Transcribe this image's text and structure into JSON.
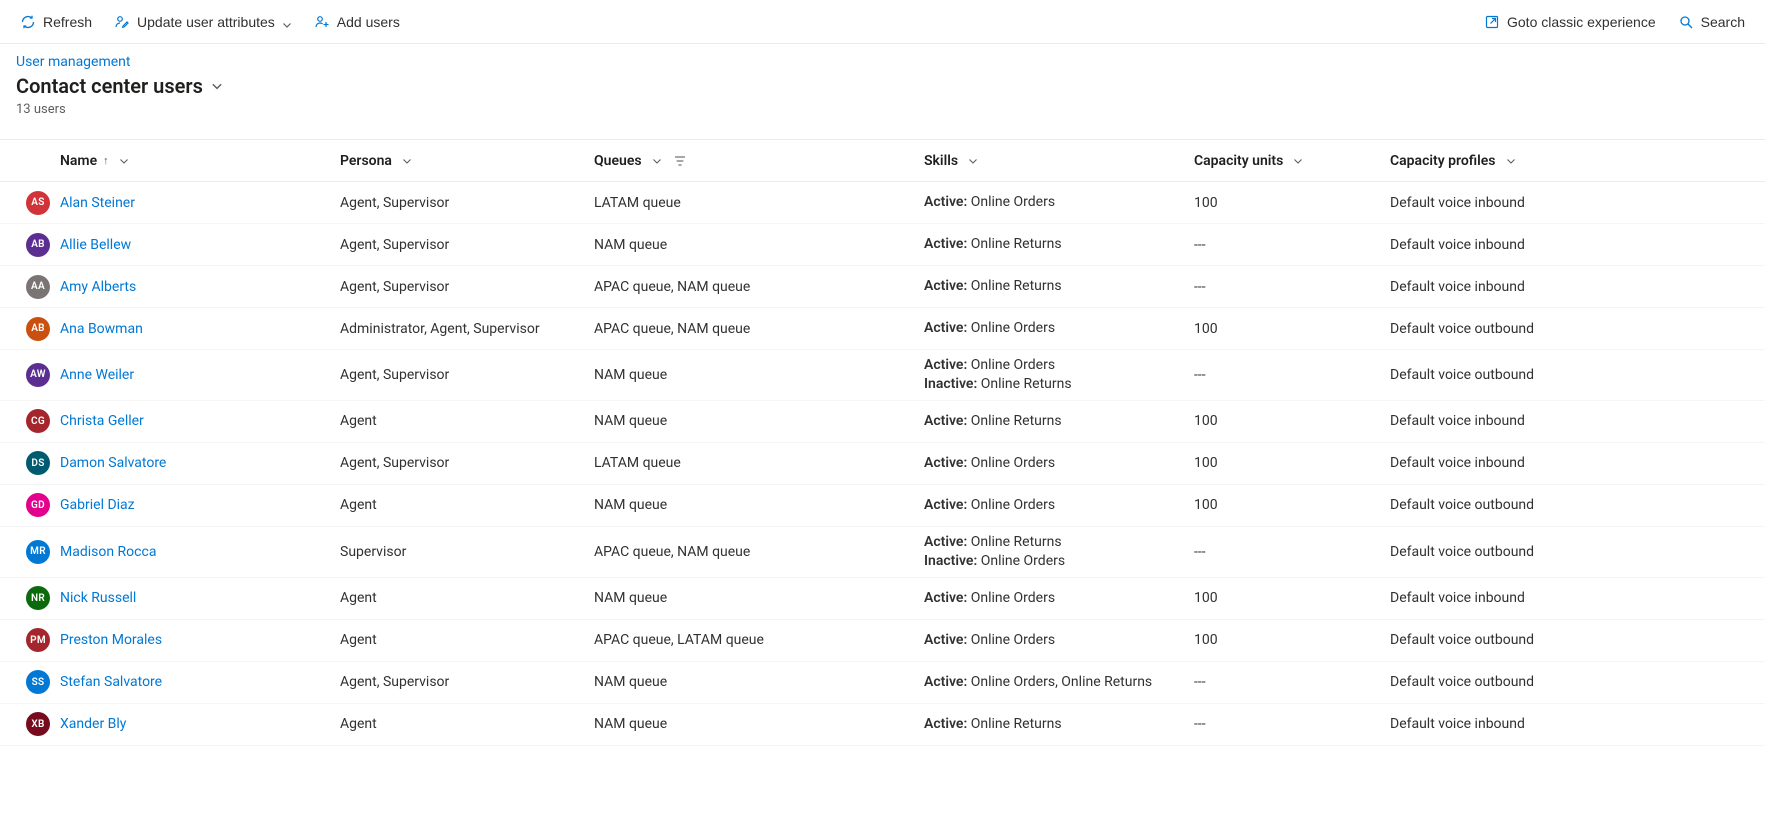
{
  "cmdbar": {
    "refresh": "Refresh",
    "update_attrs": "Update user attributes",
    "add_users": "Add users",
    "classic": "Goto classic experience",
    "search": "Search"
  },
  "breadcrumb": {
    "parent": "User management"
  },
  "title": "Contact center users",
  "subcount": "13 users",
  "columns": {
    "name": "Name",
    "persona": "Persona",
    "queues": "Queues",
    "skills": "Skills",
    "capacity_units": "Capacity units",
    "capacity_profiles": "Capacity profiles",
    "sort_asc_glyph": "↑"
  },
  "skill_labels": {
    "active": "Active:",
    "inactive": "Inactive:"
  },
  "rows": [
    {
      "initials": "AS",
      "avatarColor": "#d13438",
      "name": "Alan Steiner",
      "persona": "Agent, Supervisor",
      "queues": "LATAM queue",
      "skills": [
        {
          "state": "active",
          "text": "Online Orders"
        }
      ],
      "capacity": "100",
      "profiles": "Default voice inbound"
    },
    {
      "initials": "AB",
      "avatarColor": "#5c2e91",
      "name": "Allie Bellew",
      "persona": "Agent, Supervisor",
      "queues": "NAM queue",
      "skills": [
        {
          "state": "active",
          "text": "Online Returns"
        }
      ],
      "capacity": "---",
      "profiles": "Default voice inbound"
    },
    {
      "initials": "AA",
      "avatarColor": "#7a7574",
      "name": "Amy Alberts",
      "persona": "Agent, Supervisor",
      "queues": "APAC queue, NAM queue",
      "skills": [
        {
          "state": "active",
          "text": "Online Returns"
        }
      ],
      "capacity": "---",
      "profiles": "Default voice inbound"
    },
    {
      "initials": "AB",
      "avatarColor": "#ca5010",
      "name": "Ana Bowman",
      "persona": "Administrator, Agent, Supervisor",
      "queues": "APAC queue, NAM queue",
      "skills": [
        {
          "state": "active",
          "text": "Online Orders"
        }
      ],
      "capacity": "100",
      "profiles": "Default voice outbound"
    },
    {
      "initials": "AW",
      "avatarColor": "#5c2e91",
      "name": "Anne Weiler",
      "persona": "Agent, Supervisor",
      "queues": "NAM queue",
      "skills": [
        {
          "state": "active",
          "text": "Online Orders"
        },
        {
          "state": "inactive",
          "text": "Online Returns"
        }
      ],
      "capacity": "---",
      "profiles": "Default voice outbound"
    },
    {
      "initials": "CG",
      "avatarColor": "#a4262c",
      "name": "Christa Geller",
      "persona": "Agent",
      "queues": "NAM queue",
      "skills": [
        {
          "state": "active",
          "text": "Online Returns"
        }
      ],
      "capacity": "100",
      "profiles": "Default voice inbound"
    },
    {
      "initials": "DS",
      "avatarColor": "#005b70",
      "name": "Damon Salvatore",
      "persona": "Agent, Supervisor",
      "queues": "LATAM queue",
      "skills": [
        {
          "state": "active",
          "text": "Online Orders"
        }
      ],
      "capacity": "100",
      "profiles": "Default voice inbound"
    },
    {
      "initials": "GD",
      "avatarColor": "#e3008c",
      "name": "Gabriel Diaz",
      "persona": "Agent",
      "queues": "NAM queue",
      "skills": [
        {
          "state": "active",
          "text": "Online Orders"
        }
      ],
      "capacity": "100",
      "profiles": "Default voice outbound"
    },
    {
      "initials": "MR",
      "avatarColor": "#0078d4",
      "name": "Madison Rocca",
      "persona": "Supervisor",
      "queues": "APAC queue, NAM queue",
      "skills": [
        {
          "state": "active",
          "text": "Online Returns"
        },
        {
          "state": "inactive",
          "text": "Online Orders"
        }
      ],
      "capacity": "---",
      "profiles": "Default voice outbound"
    },
    {
      "initials": "NR",
      "avatarColor": "#0b6a0b",
      "name": "Nick Russell",
      "persona": "Agent",
      "queues": "NAM queue",
      "skills": [
        {
          "state": "active",
          "text": "Online Orders"
        }
      ],
      "capacity": "100",
      "profiles": "Default voice inbound"
    },
    {
      "initials": "PM",
      "avatarColor": "#a4262c",
      "name": "Preston Morales",
      "persona": "Agent",
      "queues": "APAC queue, LATAM queue",
      "skills": [
        {
          "state": "active",
          "text": "Online Orders"
        }
      ],
      "capacity": "100",
      "profiles": "Default voice outbound"
    },
    {
      "initials": "SS",
      "avatarColor": "#0078d4",
      "name": "Stefan Salvatore",
      "persona": "Agent, Supervisor",
      "queues": "NAM queue",
      "skills": [
        {
          "state": "active",
          "text": "Online Orders, Online Returns"
        }
      ],
      "capacity": "---",
      "profiles": "Default voice outbound"
    },
    {
      "initials": "XB",
      "avatarColor": "#750b1c",
      "name": "Xander Bly",
      "persona": "Agent",
      "queues": "NAM queue",
      "skills": [
        {
          "state": "active",
          "text": "Online Returns"
        }
      ],
      "capacity": "---",
      "profiles": "Default voice inbound"
    }
  ]
}
